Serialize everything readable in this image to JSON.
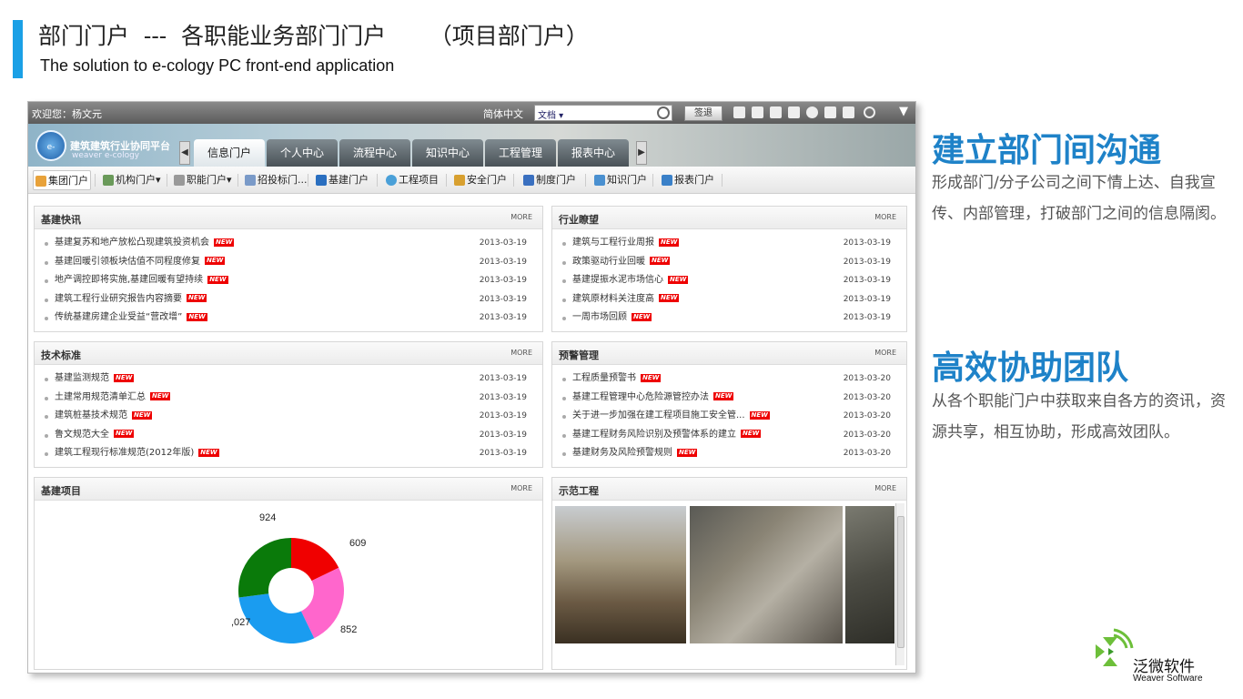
{
  "slide": {
    "title": "部门门户  ---  各职能业务部门门户      （项目部门户）",
    "subtitle": "The solution to e-cology PC front-end application"
  },
  "app": {
    "welcome": "欢迎您：杨文元",
    "language": "简体中文",
    "search_value": "文档 ▾",
    "logout_label": "签退",
    "brand_name": "建筑建筑行业协同平台",
    "brand_sub": "weaver e-cology",
    "logo_text": "e-cology",
    "nav_tabs": [
      "信息门户",
      "个人中心",
      "流程中心",
      "知识中心",
      "工程管理",
      "报表中心"
    ],
    "sub_nav": [
      "集团门户",
      "机构门户▾",
      "职能门户▾",
      "招投标门...",
      "基建门户",
      "工程项目",
      "安全门户",
      "制度门户",
      "知识门户",
      "报表门户"
    ]
  },
  "panels": {
    "more_label": "MORE",
    "new_badge": "NEW",
    "p1": {
      "title": "基建快讯",
      "items": [
        {
          "text": "基建复苏和地产放松凸现建筑投资机会",
          "date": "2013-03-19"
        },
        {
          "text": "基建回暖引领板块估值不同程度修复",
          "date": "2013-03-19"
        },
        {
          "text": "地产调控即将实施,基建回暖有望持续",
          "date": "2013-03-19"
        },
        {
          "text": "建筑工程行业研究报告内容摘要",
          "date": "2013-03-19"
        },
        {
          "text": "传统基建房建企业受益“营改增”",
          "date": "2013-03-19"
        }
      ]
    },
    "p2": {
      "title": "行业瞭望",
      "items": [
        {
          "text": "建筑与工程行业周报",
          "date": "2013-03-19"
        },
        {
          "text": "政策驱动行业回暖",
          "date": "2013-03-19"
        },
        {
          "text": "基建提振水泥市场信心",
          "date": "2013-03-19"
        },
        {
          "text": "建筑原材料关注度高",
          "date": "2013-03-19"
        },
        {
          "text": "一周市场回顾",
          "date": "2013-03-19"
        }
      ]
    },
    "p3": {
      "title": "技术标准",
      "items": [
        {
          "text": "基建监测规范",
          "date": "2013-03-19"
        },
        {
          "text": "土建常用规范清单汇总",
          "date": "2013-03-19"
        },
        {
          "text": "建筑桩基技术规范",
          "date": "2013-03-19"
        },
        {
          "text": "鲁文规范大全",
          "date": "2013-03-19"
        },
        {
          "text": "建筑工程现行标准规范(2012年版)",
          "date": "2013-03-19"
        }
      ]
    },
    "p4": {
      "title": "预警管理",
      "items": [
        {
          "text": "工程质量预警书",
          "date": "2013-03-20"
        },
        {
          "text": "基建工程管理中心危险源管控办法",
          "date": "2013-03-20"
        },
        {
          "text": "关于进一步加强在建工程项目施工安全管...",
          "date": "2013-03-20"
        },
        {
          "text": "基建工程财务风险识别及预警体系的建立",
          "date": "2013-03-20"
        },
        {
          "text": "基建财务及风险预警规则",
          "date": "2013-03-20"
        }
      ]
    },
    "p5": {
      "title": "基建项目"
    },
    "p6": {
      "title": "示范工程"
    }
  },
  "chart_data": {
    "type": "pie",
    "labels": [
      "609",
      "852",
      ",027",
      "924"
    ],
    "values": [
      609,
      852,
      1027,
      924
    ],
    "colors": [
      "#f00000",
      "#ff66cc",
      "#1a9cf0",
      "#0a7a0a"
    ]
  },
  "right": {
    "h1": "建立部门间沟通",
    "p1": "形成部门/分子公司之间下情上达、自我宣传、内部管理，打破部门之间的信息隔阂。",
    "h2": "高效协助团队",
    "p2": "从各个职能门户中获取来自各方的资讯，资源共享，相互协助，形成高效团队。"
  },
  "footer": {
    "brand_cn": "泛微软件",
    "brand_en": "Weaver Software"
  }
}
